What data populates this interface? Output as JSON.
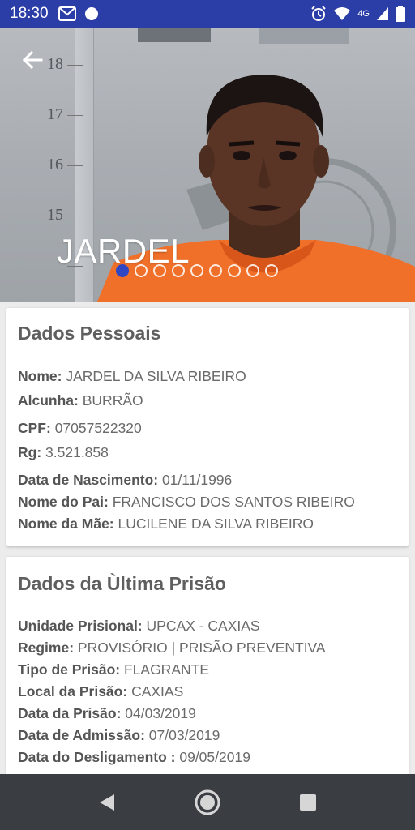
{
  "status_bar": {
    "time": "18:30",
    "network_label": "4G",
    "icons": [
      "gmail-icon",
      "notification-dot-icon",
      "alarm-icon",
      "wifi-icon",
      "signal-icon",
      "battery-icon"
    ]
  },
  "hero": {
    "name": "JARDEL",
    "ruler_numbers": [
      "18",
      "17",
      "16",
      "15",
      "14"
    ],
    "carousel_total": 9,
    "carousel_active": 1
  },
  "personal": {
    "title": "Dados Pessoais",
    "nome_label": "Nome:",
    "nome": "JARDEL DA SILVA RIBEIRO",
    "alcunha_label": "Alcunha:",
    "alcunha": "BURRÃO",
    "cpf_label": "CPF:",
    "cpf": "07057522320",
    "rg_label": "Rg:",
    "rg": "3.521.858",
    "nascimento_label": "Data de Nascimento:",
    "nascimento": "01/11/1996",
    "pai_label": "Nome do Pai:",
    "pai": "FRANCISCO DOS SANTOS RIBEIRO",
    "mae_label": "Nome da Mãe:",
    "mae": "LUCILENE DA SILVA RIBEIRO"
  },
  "prison": {
    "title": "Dados da Ùltima Prisão",
    "unidade_label": "Unidade Prisional:",
    "unidade": "UPCAX - CAXIAS",
    "regime_label": "Regime:",
    "regime": "PROVISÓRIO | PRISÃO PREVENTIVA",
    "tipo_label": "Tipo de Prisão:",
    "tipo": "FLAGRANTE",
    "local_label": "Local da Prisão:",
    "local": "CAXIAS",
    "data_prisao_label": "Data da Prisão:",
    "data_prisao": "04/03/2019",
    "admissao_label": "Data de Admissão:",
    "admissao": "07/03/2019",
    "desligamento_label": "Data do Desligamento :",
    "desligamento": "09/05/2019"
  },
  "colors": {
    "status_bar": "#2b3ea8",
    "accent": "#3047c3",
    "prison_uniform": "#f0702a",
    "nav_bar": "#3a3d42"
  }
}
